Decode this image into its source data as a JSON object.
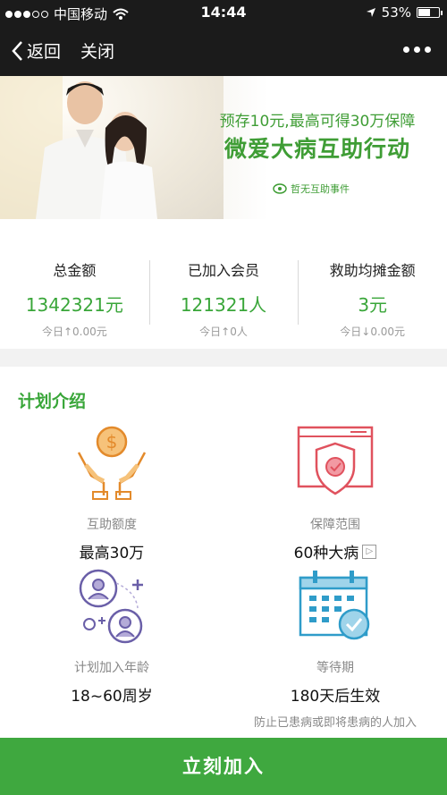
{
  "statusbar": {
    "carrier": "中国移动",
    "time": "14:44",
    "battery": "53%",
    "battery_level": 0.53
  },
  "navbar": {
    "back_label": "返回",
    "close_label": "关闭"
  },
  "banner": {
    "line1": "预存10元,最高可得30万保障",
    "line2": "微爱大病互助行动",
    "org": "哲无互助事件"
  },
  "stats": [
    {
      "label": "总金额",
      "value": "1342321元",
      "today": "今日↑0.00元"
    },
    {
      "label": "已加入会员",
      "value": "121321人",
      "today": "今日↑0人"
    },
    {
      "label": "救助均摊金额",
      "value": "3元",
      "today": "今日↓0.00元"
    }
  ],
  "intro": {
    "title": "计划介绍",
    "features": [
      {
        "label": "互助额度",
        "value": "最高30万"
      },
      {
        "label": "保障范围",
        "value": "60种大病"
      },
      {
        "label": "计划加入年龄",
        "value": "18~60周岁"
      },
      {
        "label": "等待期",
        "value": "180天后生效",
        "note": "防止已患病或即将患病的人加入"
      }
    ]
  },
  "cta": {
    "label": "立刻加入"
  },
  "colors": {
    "accent": "#3fa83f",
    "icon_orange": "#e38a2b",
    "icon_red": "#e0525e",
    "icon_purple": "#6a5fa8",
    "icon_blue": "#2f9cc9"
  }
}
